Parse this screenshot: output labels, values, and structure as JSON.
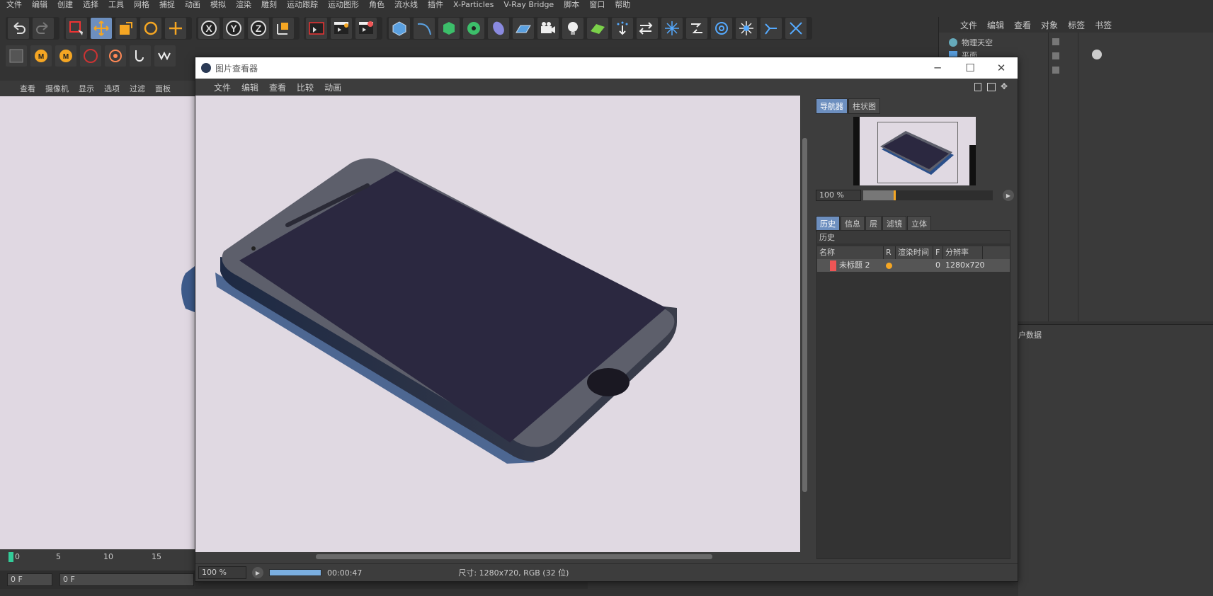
{
  "menubar": {
    "items": [
      "文件",
      "编辑",
      "创建",
      "选择",
      "工具",
      "网格",
      "捕捉",
      "动画",
      "模拟",
      "渲染",
      "雕刻",
      "运动跟踪",
      "运动图形",
      "角色",
      "流水线",
      "插件",
      "X-Particles",
      "V-Ray Bridge",
      "脚本",
      "窗口",
      "帮助"
    ]
  },
  "left_panel": {
    "menu": [
      "查看",
      "摄像机",
      "显示",
      "选项",
      "过滤",
      "面板"
    ],
    "timeline_ticks": [
      "0",
      "5",
      "10",
      "15"
    ],
    "frame_start": "0 F",
    "frame_field": "0 F"
  },
  "object_manager": {
    "menu": [
      "文件",
      "编辑",
      "查看",
      "对象",
      "标签",
      "书签"
    ],
    "objects": [
      "物理天空",
      "平面"
    ]
  },
  "attribute_panel": {
    "label": "户数据"
  },
  "viewer": {
    "title": "图片查看器",
    "menu": [
      "文件",
      "编辑",
      "查看",
      "比较",
      "动画"
    ],
    "nav_tabs": [
      "导航器",
      "柱状图"
    ],
    "nav_zoom": "100 %",
    "history_tabs": [
      "历史",
      "信息",
      "层",
      "滤镜",
      "立体"
    ],
    "history_title": "历史",
    "columns": [
      "名称",
      "R",
      "渲染时间",
      "F",
      "分辨率"
    ],
    "history_rows": [
      {
        "name": "未标题 2",
        "frame": "0",
        "resolution": "1280x720"
      }
    ],
    "status_zoom": "100 %",
    "status_time": "00:00:47",
    "status_info": "尺寸: 1280x720, RGB (32 位)"
  },
  "colors": {
    "accent": "#6d8fbf",
    "orange": "#f5a623",
    "render_bg": "#e0d9e2",
    "phone_body": "#5d5f6b",
    "phone_screen": "#2b2840",
    "shadow": "#3d5a8a"
  }
}
